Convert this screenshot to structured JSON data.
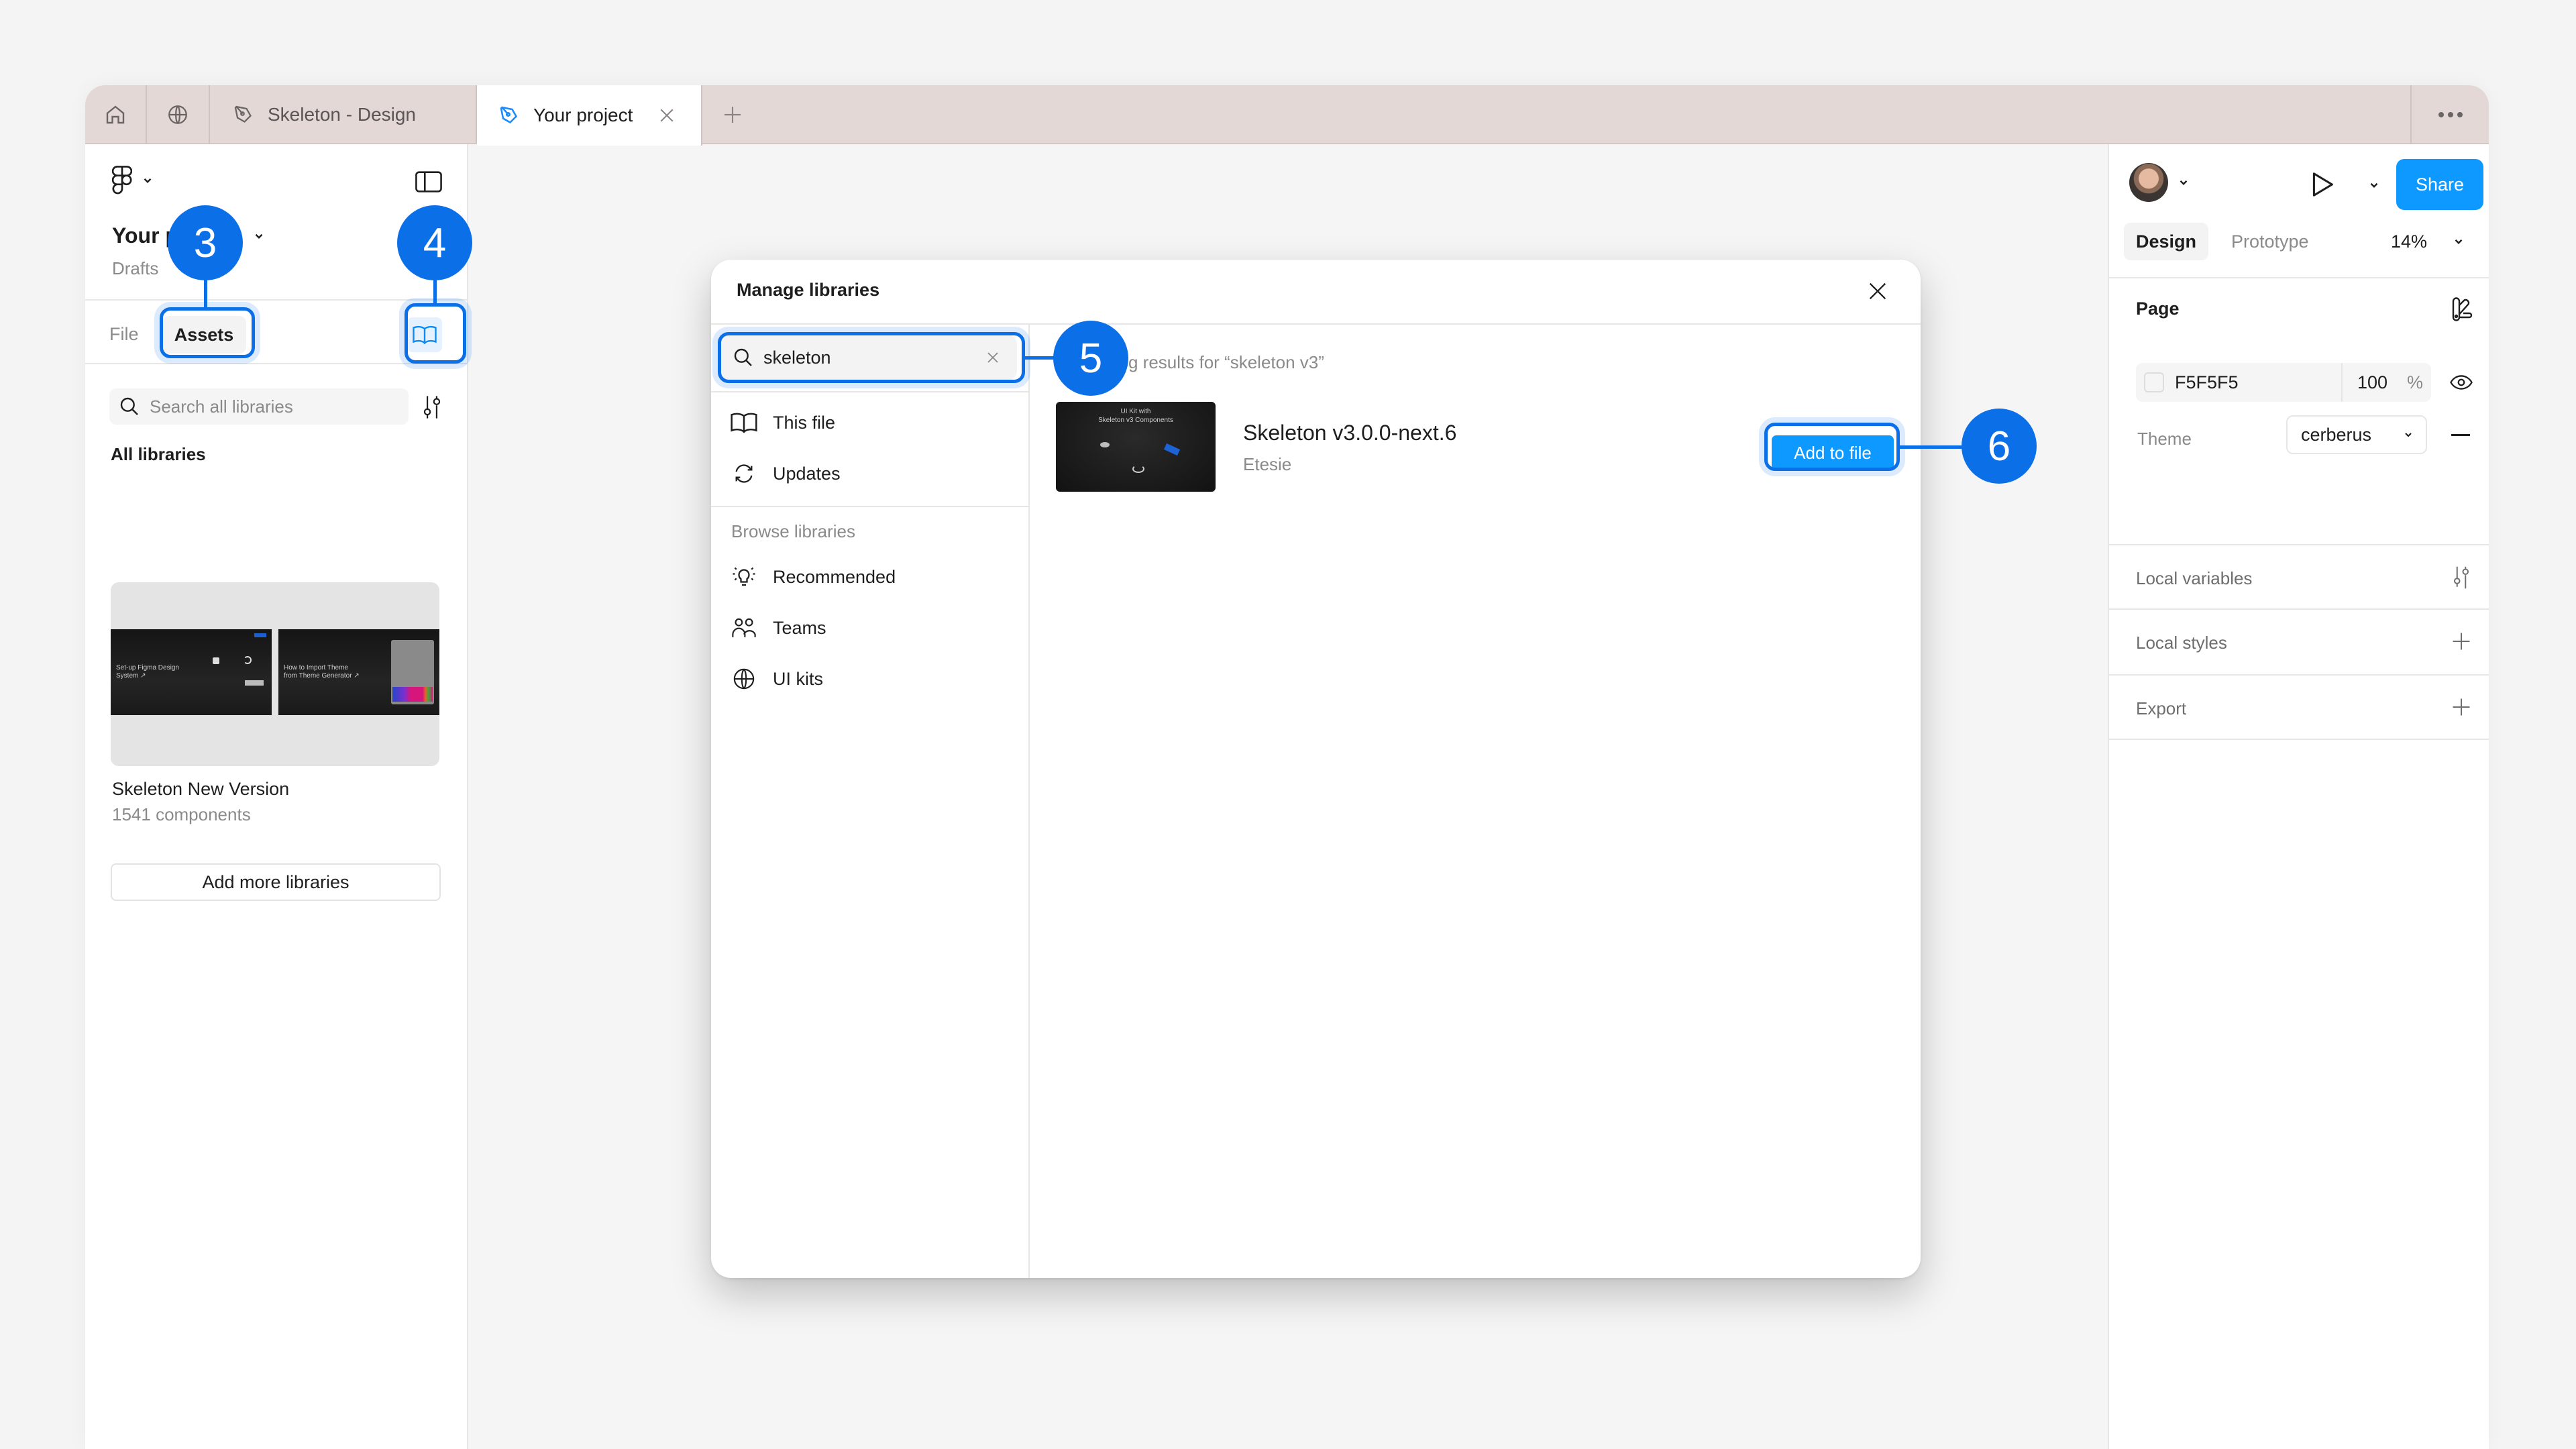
{
  "tabs": {
    "home_icon": "home-icon",
    "community_icon": "globe-icon",
    "items": [
      {
        "label": "Skeleton - Design",
        "icon": "figma-file-icon",
        "active": false
      },
      {
        "label": "Your project",
        "icon": "figma-file-icon",
        "active": true
      }
    ],
    "new_tab_icon": "plus-icon",
    "more_icon": "ellipsis-icon"
  },
  "left_panel": {
    "project_title": "Your project",
    "project_title_visible": "Your p",
    "location": "Drafts",
    "tabs": [
      {
        "label": "File",
        "active": false
      },
      {
        "label": "Assets",
        "active": true
      }
    ],
    "search_placeholder": "Search all libraries",
    "section_title": "All libraries",
    "library": {
      "name": "Skeleton New Version",
      "count": "1541 components",
      "thumbnails": [
        {
          "line1": "Set-up Figma Design",
          "line2": "System ↗"
        },
        {
          "line1": "How to Import Theme",
          "line2": "from Theme Generator ↗"
        }
      ]
    },
    "add_more_label": "Add more libraries"
  },
  "annotations": [
    {
      "number": "3",
      "target": "Assets tab"
    },
    {
      "number": "4",
      "target": "Libraries button"
    },
    {
      "number": "5",
      "target": "Library search input"
    },
    {
      "number": "6",
      "target": "Add to file button"
    }
  ],
  "modal": {
    "title": "Manage libraries",
    "search_value": "skeleton",
    "nav_items": [
      {
        "label": "This file",
        "icon": "book-icon"
      },
      {
        "label": "Updates",
        "icon": "refresh-icon"
      }
    ],
    "browse_label": "Browse libraries",
    "browse_items": [
      {
        "label": "Recommended",
        "icon": "lightbulb-icon"
      },
      {
        "label": "Teams",
        "icon": "team-icon"
      },
      {
        "label": "UI kits",
        "icon": "globe-icon"
      }
    ],
    "results_caption": "Showing results for “skeleton v3”",
    "results_caption_visible": "g results for “skeleton v3”",
    "result": {
      "name": "Skeleton v3.0.0-next.6",
      "author": "Etesie",
      "thumb_line1": "UI Kit with",
      "thumb_line2": "Skeleton v3 Components",
      "action_label": "Add to file"
    }
  },
  "right_panel": {
    "share_label": "Share",
    "tabs": [
      {
        "label": "Design",
        "active": true
      },
      {
        "label": "Prototype",
        "active": false
      }
    ],
    "zoom": "14%",
    "page_section": "Page",
    "page_color": "F5F5F5",
    "page_opacity": "100",
    "percent_sign": "%",
    "theme_label": "Theme",
    "theme_value": "cerberus",
    "sections": [
      {
        "label": "Local variables",
        "icon": "variables-icon"
      },
      {
        "label": "Local styles",
        "icon": "plus-icon"
      },
      {
        "label": "Export",
        "icon": "plus-icon"
      }
    ]
  },
  "colors": {
    "accent": "#0d99ff",
    "annotation": "#0b6fe8",
    "tabbar": "#e3d8d6",
    "page_bg": "#f5f5f5"
  }
}
